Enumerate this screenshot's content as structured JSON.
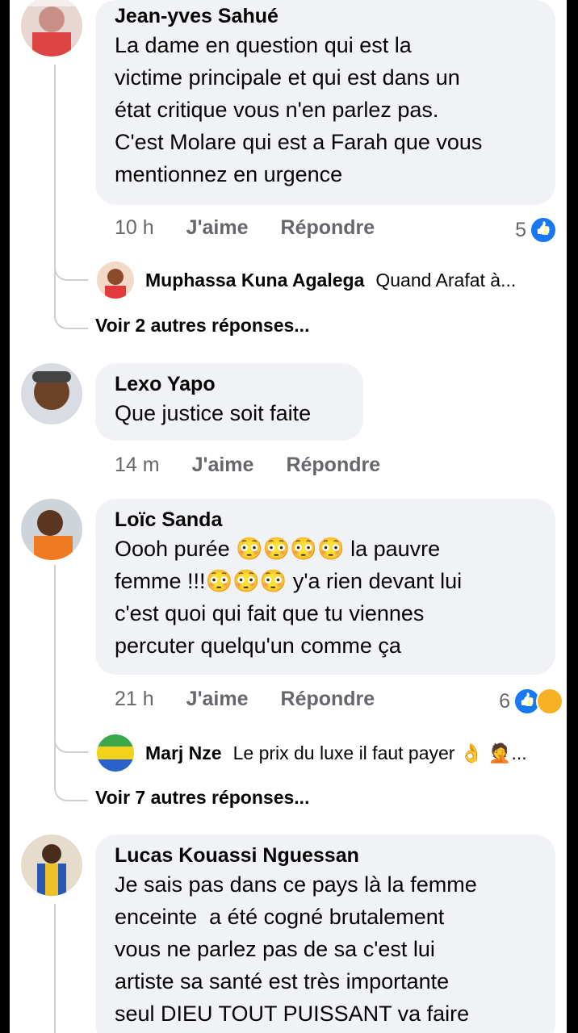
{
  "comments": [
    {
      "author": "Jean-yves Sahué",
      "text": "La dame en question qui est la\nvictime principale et qui est dans un\nétat critique vous n'en parlez pas.\nC'est Molare qui est a Farah que vous\nmentionnez en urgence",
      "time": "10 h",
      "like": "J'aime",
      "reply": "Répondre",
      "reaction_count": "5",
      "reply_preview": {
        "name": "Muphassa Kuna Agalega",
        "text": "Quand Arafat à..."
      },
      "more_replies": "Voir 2 autres réponses..."
    },
    {
      "author": "Lexo Yapo",
      "text": "Que justice soit faite",
      "time": "14 m",
      "like": "J'aime",
      "reply": "Répondre"
    },
    {
      "author": "Loïc Sanda",
      "text": "Oooh purée 😳😳😳😳 la pauvre\nfemme !!!😳😳😳 y'a rien devant lui\nc'est quoi qui fait que tu viennes\npercuter quelqu'un comme ça",
      "time": "21 h",
      "like": "J'aime",
      "reply": "Répondre",
      "reaction_count": "6",
      "reply_preview": {
        "name": "Marj Nze",
        "text": "Le prix du luxe il faut payer 👌 🤦..."
      },
      "more_replies": "Voir 7 autres réponses..."
    },
    {
      "author": "Lucas Kouassi Nguessan",
      "text": "Je sais pas dans ce pays là la femme\nenceinte  a été cogné brutalement\nvous ne parlez pas de sa c'est lui\nartiste sa santé est très importante\nseul DIEU TOUT PUISSANT va faire"
    }
  ],
  "colors": {
    "like_blue": "#1877f2",
    "bubble": "#f0f2f5",
    "muted": "#65676b"
  }
}
